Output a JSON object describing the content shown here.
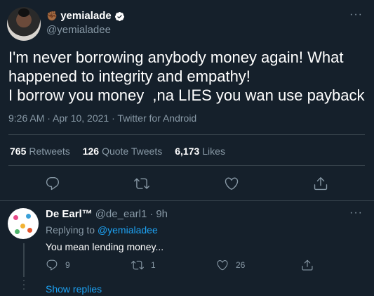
{
  "tweet": {
    "emoji": "✊🏾",
    "display_name": "yemialade",
    "handle": "@yemialadee",
    "more": "···",
    "lines": [
      "I'm never borrowing anybody money again! What",
      "happened to integrity and empathy!",
      "I borrow you money  ,na LIES you wan use payback"
    ],
    "meta": "9:26 AM · Apr 10, 2021 · Twitter for Android",
    "stats": {
      "retweets_count": "765",
      "retweets_label": "Retweets",
      "quotes_count": "126",
      "quotes_label": "Quote Tweets",
      "likes_count": "6,173",
      "likes_label": "Likes"
    }
  },
  "reply": {
    "display_name": "De Earl™",
    "handle": "@de_earl1",
    "separator": "·",
    "time": "9h",
    "more": "···",
    "replying_prefix": "Replying to ",
    "replying_to": "@yemialadee",
    "text": "You mean lending money...",
    "reply_count": "9",
    "retweet_count": "1",
    "like_count": "26"
  },
  "show_replies": "Show replies",
  "colors": {
    "background": "#15202b",
    "accent": "#1da1f2",
    "muted": "#8899a6",
    "border": "#38444d"
  }
}
